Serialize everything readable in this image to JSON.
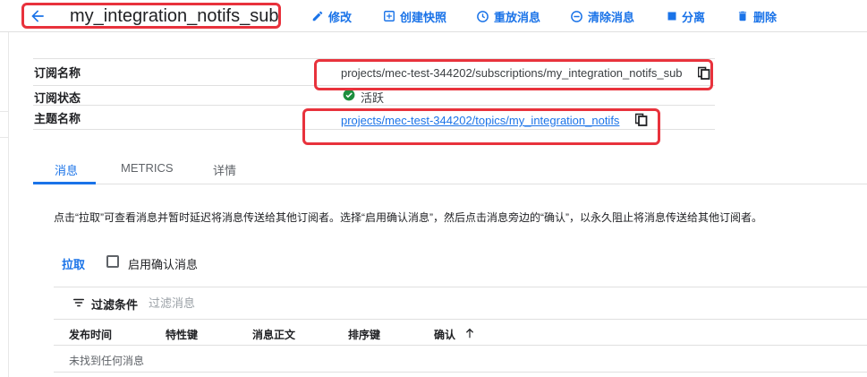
{
  "header": {
    "title": "my_integration_notifs_sub",
    "actions": [
      {
        "label": "修改",
        "icon": "pencil-icon"
      },
      {
        "label": "创建快照",
        "icon": "snapshot-icon"
      },
      {
        "label": "重放消息",
        "icon": "replay-icon"
      },
      {
        "label": "清除消息",
        "icon": "purge-icon"
      },
      {
        "label": "分离",
        "icon": "stop-icon"
      },
      {
        "label": "删除",
        "icon": "trash-icon"
      }
    ]
  },
  "details": {
    "subscription_name_label": "订阅名称",
    "subscription_name_value": "projects/mec-test-344202/subscriptions/my_integration_notifs_sub",
    "status_label": "订阅状态",
    "status_value": "活跃",
    "topic_label": "主题名称",
    "topic_value": "projects/mec-test-344202/topics/my_integration_notifs"
  },
  "tabs": [
    {
      "label": "消息",
      "active": true
    },
    {
      "label": "METRICS",
      "active": false
    },
    {
      "label": "详情",
      "active": false
    }
  ],
  "messages": {
    "description": "点击“拉取”可查看消息并暂时延迟将消息传送给其他订阅者。选择“启用确认消息”，然后点击消息旁边的“确认”，以永久阻止将消息传送给其他订阅者。",
    "pull_label": "拉取",
    "enable_ack_label": "启用确认消息",
    "enable_ack_checked": false,
    "filter_label": "过滤条件",
    "filter_placeholder": "过滤消息",
    "columns": [
      "发布时间",
      "特性键",
      "消息正文",
      "排序键",
      "确认"
    ],
    "empty_text": "未找到任何消息"
  },
  "colors": {
    "accent": "#1a73e8",
    "highlight": "#e8323c",
    "status_active": "#1e8e3e"
  }
}
